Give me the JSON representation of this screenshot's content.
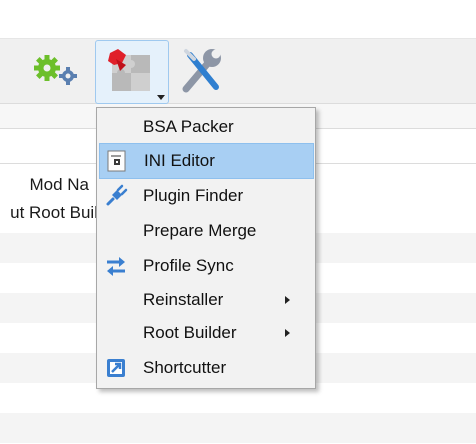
{
  "background_list": {
    "rows": [
      {
        "text": "Mod Na"
      },
      {
        "text": "ut Root Buil"
      }
    ]
  },
  "toolbar": {
    "buttons": [
      {
        "icon": "gears-icon"
      },
      {
        "icon": "puzzle-tools-icon",
        "active": true
      },
      {
        "icon": "wrench-screwdriver-icon"
      }
    ]
  },
  "menu": {
    "items": [
      {
        "label": "BSA Packer",
        "icon": ""
      },
      {
        "label": "INI Editor",
        "icon": "ini-file-icon",
        "highlighted": true
      },
      {
        "label": "Plugin Finder",
        "icon": "plug-icon"
      },
      {
        "label": "Prepare Merge",
        "icon": ""
      },
      {
        "label": "Profile Sync",
        "icon": "sync-arrows-icon"
      },
      {
        "label": "Reinstaller",
        "icon": "",
        "submenu": true
      },
      {
        "label": "Root Builder",
        "icon": "",
        "submenu": true
      },
      {
        "label": "Shortcutter",
        "icon": "shortcut-icon"
      }
    ]
  },
  "colors": {
    "highlight": "#a8cff3",
    "menu_bg": "#f2f2f2",
    "toolbar_bg": "#f0f0f0"
  }
}
